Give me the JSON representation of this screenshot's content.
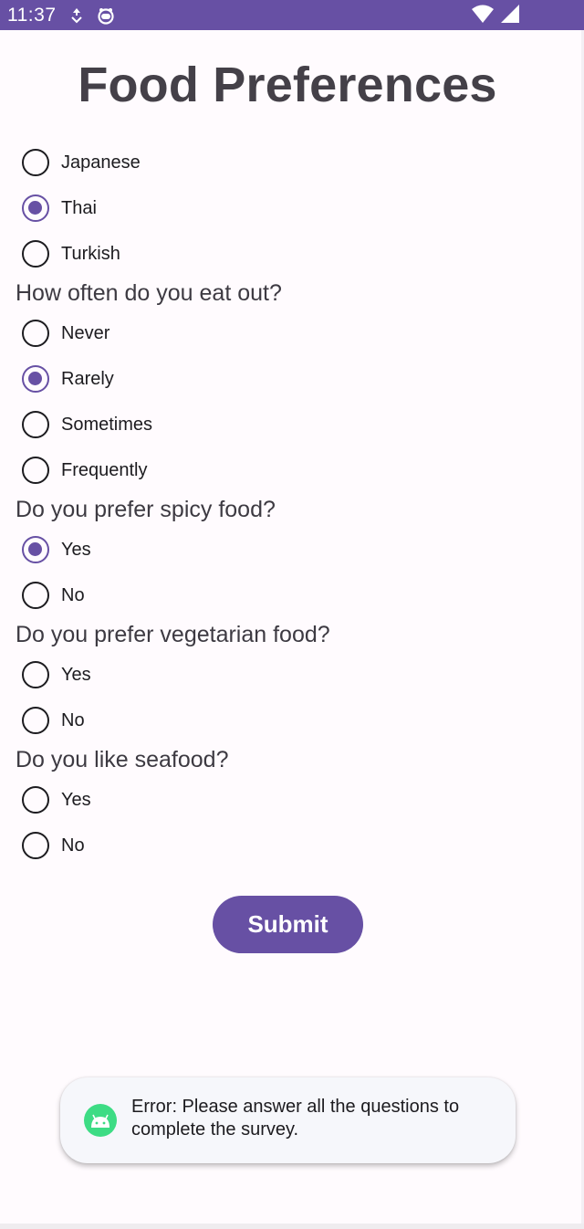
{
  "status_bar": {
    "time": "11:37"
  },
  "title": "Food Preferences",
  "groups": [
    {
      "question": "",
      "options": [
        {
          "label": "Japanese",
          "checked": false
        },
        {
          "label": "Thai",
          "checked": true
        },
        {
          "label": "Turkish",
          "checked": false
        }
      ]
    },
    {
      "question": "How often do you eat out?",
      "options": [
        {
          "label": "Never",
          "checked": false
        },
        {
          "label": "Rarely",
          "checked": true
        },
        {
          "label": "Sometimes",
          "checked": false
        },
        {
          "label": "Frequently",
          "checked": false
        }
      ]
    },
    {
      "question": "Do you prefer spicy food?",
      "options": [
        {
          "label": "Yes",
          "checked": true
        },
        {
          "label": "No",
          "checked": false
        }
      ]
    },
    {
      "question": "Do you prefer vegetarian food?",
      "options": [
        {
          "label": "Yes",
          "checked": false
        },
        {
          "label": "No",
          "checked": false
        }
      ]
    },
    {
      "question": "Do you like seafood?",
      "options": [
        {
          "label": "Yes",
          "checked": false
        },
        {
          "label": "No",
          "checked": false
        }
      ]
    }
  ],
  "submit_label": "Submit",
  "toast": {
    "message": "Error: Please answer all the questions to complete the survey.",
    "icon": "android-icon"
  },
  "colors": {
    "primary": "#6750a4",
    "toast_icon": "#3ddc84"
  }
}
